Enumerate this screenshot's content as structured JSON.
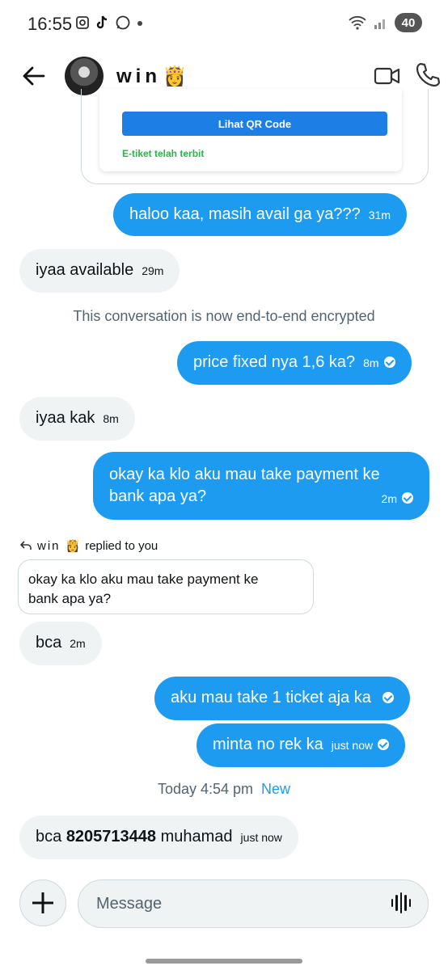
{
  "status_bar": {
    "time": "16:55",
    "left_icons": [
      "screenshot-icon",
      "tiktok-icon",
      "whatsapp-icon",
      "dot-icon"
    ],
    "battery": "40"
  },
  "header": {
    "name": "win",
    "name_emoji": "👸",
    "icons": [
      "back-arrow-icon",
      "video-call-icon",
      "phone-icon"
    ]
  },
  "card": {
    "button_label": "Lihat QR Code",
    "status": "E-tiket telah terbit"
  },
  "messages": {
    "m1": {
      "text": "haloo kaa, masih avail ga ya???",
      "time": "31m"
    },
    "m2": {
      "text": "iyaa available",
      "time": "29m"
    },
    "encrypted_notice": "This conversation is now end-to-end encrypted",
    "m3": {
      "text": "price fixed nya 1,6 ka?",
      "time": "8m"
    },
    "m4": {
      "text": "iyaa kak",
      "time": "8m"
    },
    "m5": {
      "line1": "okay ka klo aku mau take payment ke",
      "line2": "bank apa ya?",
      "time": "2m"
    },
    "reply": {
      "name": "win",
      "emoji": "👸",
      "label": "replied to you",
      "quote_line1": "okay ka klo aku mau take payment ke",
      "quote_line2": "bank apa ya?"
    },
    "m6": {
      "text": "bca",
      "time": "2m"
    },
    "m7": {
      "text": "aku mau take 1 ticket aja ka"
    },
    "m8": {
      "text": "minta no rek ka",
      "time": "just now"
    },
    "today": {
      "label": "Today 4:54 pm",
      "new": "New"
    },
    "m9": {
      "prefix": "bca",
      "account": "8205713448",
      "suffix": "muhamad",
      "time": "just now"
    }
  },
  "composer": {
    "placeholder": "Message",
    "icons": [
      "plus-icon",
      "voice-icon"
    ]
  },
  "colors": {
    "outgoing": "#1d9bf0",
    "incoming": "#eff3f4",
    "card_button": "#1d7fe6",
    "eticket_green": "#2eb24c"
  }
}
